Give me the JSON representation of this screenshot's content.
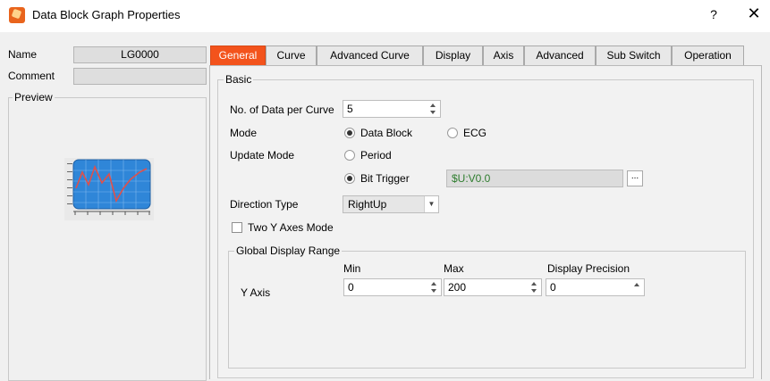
{
  "window": {
    "title": "Data Block Graph Properties",
    "help": "?",
    "close": "✕",
    "icon": "app-logo-icon"
  },
  "left": {
    "name_label": "Name",
    "name_value": "LG0000",
    "comment_label": "Comment",
    "comment_value": "",
    "preview_label": "Preview"
  },
  "tabs": [
    "General",
    "Curve",
    "Advanced Curve",
    "Display",
    "Axis",
    "Advanced",
    "Sub Switch",
    "Operation"
  ],
  "active_tab": "General",
  "basic": {
    "legend": "Basic",
    "data_per_curve_label": "No. of Data per Curve",
    "data_per_curve_value": "5",
    "mode_label": "Mode",
    "mode_options": [
      "Data Block",
      "ECG"
    ],
    "mode_selected": "Data Block",
    "update_mode_label": "Update Mode",
    "update_options": [
      "Period",
      "Bit Trigger"
    ],
    "update_selected": "Bit Trigger",
    "bit_trigger_address": "$U:V0.0",
    "browse_label": "...",
    "direction_label": "Direction Type",
    "direction_value": "RightUp",
    "two_y_axes_label": "Two Y Axes Mode",
    "two_y_axes_checked": false
  },
  "range": {
    "legend": "Global Display Range",
    "min_header": "Min",
    "max_header": "Max",
    "precision_header": "Display Precision",
    "y_axis_label": "Y Axis",
    "min_value": "0",
    "max_value": "200",
    "precision_value": "0"
  },
  "colors": {
    "accent": "#f3531c",
    "address_text": "#2e7d2e",
    "preview_plot_bg": "#2f86d8",
    "preview_curve": "#e0504a"
  }
}
